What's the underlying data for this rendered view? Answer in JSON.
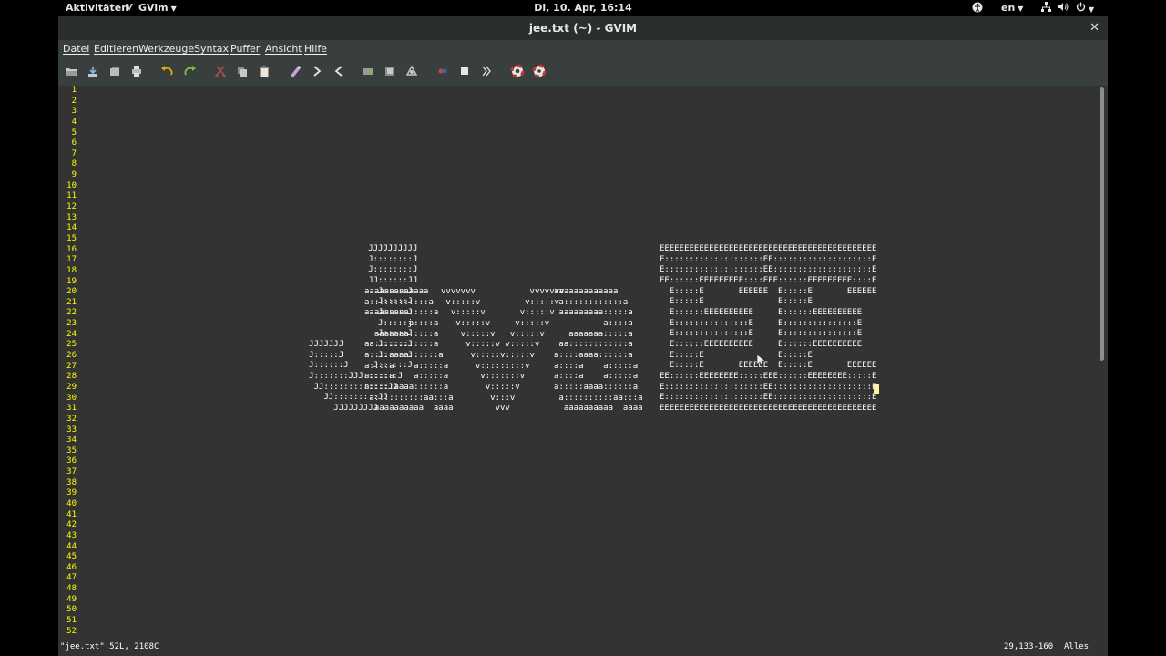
{
  "topbar": {
    "activities": "Aktivitäten",
    "app_name": "GVim",
    "clock": "Di, 10. Apr, 16:14",
    "language": "en"
  },
  "window": {
    "title": "jee.txt (~) - GVIM",
    "close_glyph": "✕"
  },
  "menu": [
    "Datei",
    "Editieren",
    "Werkzeuge",
    "Syntax",
    "Puffer",
    "Ansicht",
    "Hilfe"
  ],
  "toolbar": {
    "icons": [
      "open-icon",
      "save-icon",
      "save-all-icon",
      "print-icon",
      "undo-icon",
      "redo-icon",
      "cut-icon",
      "copy-icon",
      "paste-icon",
      "replace-icon",
      "find-next-icon",
      "find-prev-icon",
      "load-session-icon",
      "save-session-icon",
      "run-script-icon",
      "make-icon",
      "shell-icon",
      "ctags-icon",
      "help-icon",
      "find-help-icon"
    ]
  },
  "editor": {
    "line_count": 52,
    "art": {
      "j_letter": "                      JJJJJJJJJJ\n                      J::::::::J\n                      J::::::::J\n                      JJ::::::JJ\n                        J:::::J\n                        J:::::J\n                        J:::::J\n                        J:::::j\n                        J:::::J\n          JJJJJJJ       J:::::J\n          J:::::J       J:::::J\n          J::::::J     J::::::J\n          J:::::::JJJ:::::::J\n           JJ:::::::::::::JJ\n             JJ:::::::::JJ\n               JJJJJJJJJ",
      "a1_letter": "aaaaaaaaaaaaa\na::::::::::::a\naaaaaaaaa:::::a\n         a::::a\n  aaaaaaa:::::a\naa::::::::::::a\na::::aaaa::::::a\na::::a    a:::::a\na::::a    a:::::a\na:::::aaaa::::::a\n a::::::::::aa:::a\n  aaaaaaaaaa  aaaa",
      "v_letter": "vvvvvvv           vvvvvvv\n v:::::v         v:::::v\n  v:::::v       v:::::v\n   v:::::v     v:::::v\n    v:::::v   v:::::v\n     v:::::v v:::::v\n      v:::::v:::::v\n       v:::::::::v\n        v:::::::v\n         v:::::v\n          v:::v\n           vvv",
      "a2_letter": "aaaaaaaaaaaaa\n a::::::::::::a\n aaaaaaaaa:::::a\n          a::::a\n   aaaaaaa:::::a\n aa::::::::::::a\na::::aaaa::::::a\na::::a    a:::::a\na::::a    a:::::a\na:::::aaaa::::::a\n a::::::::::aa:::a\n  aaaaaaaaaa  aaaa",
      "e_letters": "EEEEEEEEEEEEEEEEEEEEEEEEEEEEEEEEEEEEEEEEEEEE\nE::::::::::::::::::::EE::::::::::::::::::::E\nE::::::::::::::::::::EE::::::::::::::::::::E\nEE::::::EEEEEEEEE::::EEE::::::EEEEEEEEE::::E\n  E:::::E       EEEEEE  E:::::E       EEEEEE\n  E:::::E               E:::::E\n  E::::::EEEEEEEEEE     E::::::EEEEEEEEEE\n  E:::::::::::::::E     E:::::::::::::::E\n  E:::::::::::::::E     E:::::::::::::::E\n  E::::::EEEEEEEEEE     E::::::EEEEEEEEEE\n  E:::::E               E:::::E\n  E:::::E       EEEEEE  E:::::E       EEEEEE\nEE::::::EEEEEEEE:::::EEE::::::EEEEEEEE:::::E\nE::::::::::::::::::::EE::::::::::::::::::::E\nE::::::::::::::::::::EE::::::::::::::::::::E\nEEEEEEEEEEEEEEEEEEEEEEEEEEEEEEEEEEEEEEEEEEEE"
    }
  },
  "status": {
    "file_info": "\"jee.txt\" 52L, 2108C",
    "position": "29,133-160",
    "scroll_mode": "Alles"
  }
}
